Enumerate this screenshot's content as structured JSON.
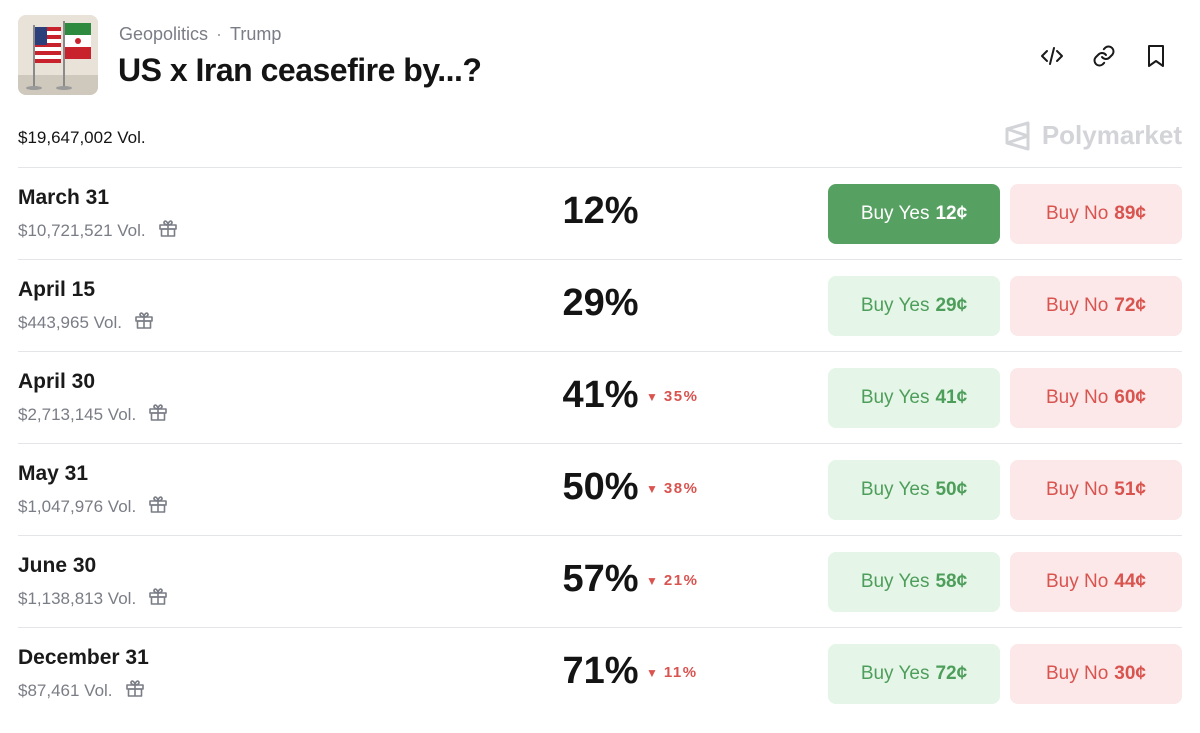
{
  "header": {
    "breadcrumb": [
      "Geopolitics",
      "Trump"
    ],
    "separator": "·",
    "title": "US x Iran ceasefire by...?",
    "total_volume": "$19,647,002 Vol.",
    "brand": "Polymarket",
    "icons": [
      "embed-icon",
      "link-icon",
      "bookmark-icon"
    ]
  },
  "markets": [
    {
      "date": "March 31",
      "volume": "$10,721,521 Vol.",
      "chance": "12%",
      "change": "",
      "yes_label": "Buy Yes",
      "yes_price": "12¢",
      "no_label": "Buy No",
      "no_price": "89¢",
      "active": true
    },
    {
      "date": "April 15",
      "volume": "$443,965 Vol.",
      "chance": "29%",
      "change": "",
      "yes_label": "Buy Yes",
      "yes_price": "29¢",
      "no_label": "Buy No",
      "no_price": "72¢",
      "active": false
    },
    {
      "date": "April 30",
      "volume": "$2,713,145 Vol.",
      "chance": "41%",
      "change": "35%",
      "yes_label": "Buy Yes",
      "yes_price": "41¢",
      "no_label": "Buy No",
      "no_price": "60¢",
      "active": false
    },
    {
      "date": "May 31",
      "volume": "$1,047,976 Vol.",
      "chance": "50%",
      "change": "38%",
      "yes_label": "Buy Yes",
      "yes_price": "50¢",
      "no_label": "Buy No",
      "no_price": "51¢",
      "active": false
    },
    {
      "date": "June 30",
      "volume": "$1,138,813 Vol.",
      "chance": "57%",
      "change": "21%",
      "yes_label": "Buy Yes",
      "yes_price": "58¢",
      "no_label": "Buy No",
      "no_price": "44¢",
      "active": false
    },
    {
      "date": "December 31",
      "volume": "$87,461 Vol.",
      "chance": "71%",
      "change": "11%",
      "yes_label": "Buy Yes",
      "yes_price": "72¢",
      "no_label": "Buy No",
      "no_price": "30¢",
      "active": false
    }
  ],
  "colors": {
    "yes": "#56a161",
    "yes_light": "#e5f5e7",
    "no": "#d9534f",
    "no_light": "#fce8e8"
  }
}
